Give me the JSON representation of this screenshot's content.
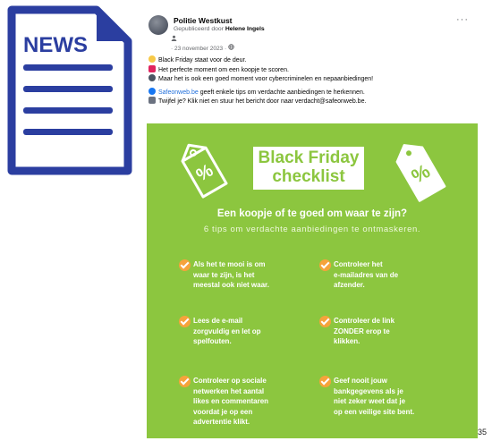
{
  "news_icon": {
    "label": "NEWS",
    "color": "#2b3ea0"
  },
  "post": {
    "page_name": "Politie Westkust",
    "published_by_prefix": "Gepubliceerd door",
    "published_by_name": "Helene Ingels",
    "date": "· 23 november 2023 ·",
    "more_label": "···",
    "lines": [
      "Black Friday staat voor de deur.",
      "Het perfecte moment om een koopje te scoren.",
      "Maar het is ook een goed moment voor cybercriminelen en nepaanbiedingen!"
    ],
    "line4_link": "Safeonweb.be",
    "line4_rest": " geeft enkele tips om verdachte aanbiedingen te herkennen.",
    "line5": "Twijfel je? Klik niet en stuur het bericht door naar verdacht@safeonweb.be."
  },
  "banner": {
    "title_line1": "Black Friday",
    "title_line2": "checklist",
    "headline": "Een koopje of te goed om waar te zijn?",
    "subline": "6 tips om verdachte aanbiedingen te ontmaskeren.",
    "tips": [
      "Als het te mooi is om\nwaar te zijn, is het\nmeestal ook niet waar.",
      "Controleer het\ne-mailadres van de\nafzender.",
      "Lees de e-mail\nzorgvuldig en let op\nspelfouten.",
      "Controleer de link\nZONDER erop te\nklikken.",
      "Controleer op sociale\nnetwerken het aantal\nlikes en commentaren\nvoordat je op een\nadvertentie klikt.",
      "Geef nooit jouw\nbankgegevens als je\nniet zeker weet dat je\nop een veilige site bent."
    ],
    "colors": {
      "green": "#8cc63f",
      "check": "#f6a33b"
    }
  },
  "page_number": "35"
}
